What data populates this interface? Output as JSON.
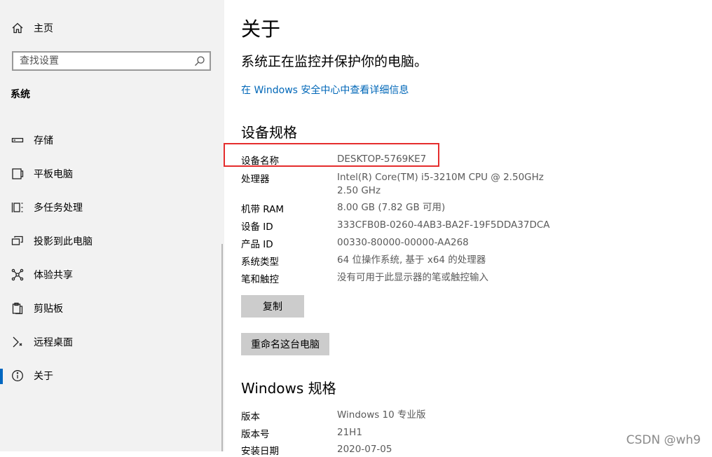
{
  "sidebar": {
    "home_label": "主页",
    "search_placeholder": "查找设置",
    "section_title": "系统",
    "items": [
      {
        "label": "存储",
        "icon": "storage-icon"
      },
      {
        "label": "平板电脑",
        "icon": "tablet-icon"
      },
      {
        "label": "多任务处理",
        "icon": "multitask-icon"
      },
      {
        "label": "投影到此电脑",
        "icon": "project-icon"
      },
      {
        "label": "体验共享",
        "icon": "share-icon"
      },
      {
        "label": "剪贴板",
        "icon": "clipboard-icon"
      },
      {
        "label": "远程桌面",
        "icon": "remote-desktop-icon"
      },
      {
        "label": "关于",
        "icon": "info-icon",
        "active": true
      }
    ]
  },
  "main": {
    "title": "关于",
    "protect_text": "系统正在监控并保护你的电脑。",
    "security_link": "在 Windows 安全中心中查看详细信息",
    "device_specs": {
      "heading": "设备规格",
      "rows": [
        {
          "label": "设备名称",
          "value": "DESKTOP-5769KE7"
        },
        {
          "label": "处理器",
          "value": "Intel(R) Core(TM) i5-3210M CPU @ 2.50GHz   2.50 GHz"
        },
        {
          "label": "机带 RAM",
          "value": "8.00 GB (7.82 GB 可用)"
        },
        {
          "label": "设备 ID",
          "value": "333CFB0B-0260-4AB3-BA2F-19F5DDA37DCA"
        },
        {
          "label": "产品 ID",
          "value": "00330-80000-00000-AA268"
        },
        {
          "label": "系统类型",
          "value": "64 位操作系统, 基于 x64 的处理器"
        },
        {
          "label": "笔和触控",
          "value": "没有可用于此显示器的笔或触控输入"
        }
      ],
      "copy_button": "复制",
      "rename_button": "重命名这台电脑"
    },
    "windows_specs": {
      "heading": "Windows 规格",
      "rows": [
        {
          "label": "版本",
          "value": "Windows 10 专业版"
        },
        {
          "label": "版本号",
          "value": "21H1"
        },
        {
          "label": "安装日期",
          "value": "2020-07-05"
        }
      ]
    }
  },
  "watermark": "CSDN @wh9",
  "colors": {
    "accent": "#0067c0",
    "link": "#0067b8",
    "highlight": "#e52d2d",
    "sidebar_bg": "#f2f2f2",
    "button_bg": "#cccccc"
  }
}
